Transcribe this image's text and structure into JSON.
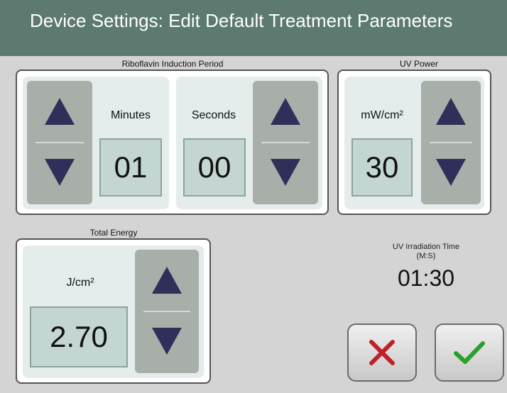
{
  "header": {
    "title": "Device Settings: Edit Default Treatment Parameters"
  },
  "riboflavin": {
    "label": "Riboflavin Induction Period",
    "minutes_label": "Minutes",
    "minutes_value": "01",
    "seconds_label": "Seconds",
    "seconds_value": "00"
  },
  "uv_power": {
    "label": "UV Power",
    "unit": "mW/cm²",
    "value": "30"
  },
  "total_energy": {
    "label": "Total Energy",
    "unit": "J/cm²",
    "value": "2.70"
  },
  "irradiation": {
    "label_line1": "UV Irradiation Time",
    "label_line2": "(M:S)",
    "value": "01:30"
  },
  "actions": {
    "cancel_icon": "x-icon",
    "confirm_icon": "check-icon",
    "cancel_color": "#c0202a",
    "confirm_color": "#2aa02a"
  },
  "colors": {
    "header_bg": "#5c7a6f",
    "arrow": "#2f2f5a",
    "value_bg": "#c4d6d2"
  }
}
